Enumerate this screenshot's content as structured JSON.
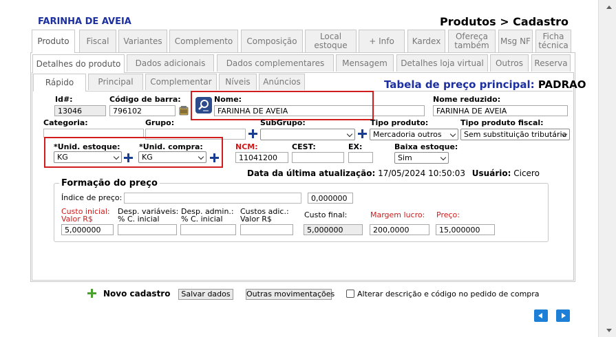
{
  "record_title": "FARINHA DE AVEIA",
  "page_heading": "Produtos > Cadastro",
  "tabs_l1": [
    "Produto",
    "Fiscal",
    "Variantes",
    "Complemento",
    "Composição",
    "Local estoque",
    "+ Info",
    "Kardex",
    "Ofereça também",
    "Msg NF",
    "Ficha técnica"
  ],
  "tabs_l2": [
    "Detalhes do produto",
    "Dados adicionais",
    "Dados complementares",
    "Mensagem",
    "Detalhes loja virtual",
    "Outros",
    "Reserva"
  ],
  "tabs_l3": [
    "Rápido",
    "Principal",
    "Complementar",
    "Níveis",
    "Anúncios"
  ],
  "price_table": {
    "label": "Tabela de preço principal:",
    "value": "PADRAO"
  },
  "form": {
    "id_label": "Id#:",
    "id_value": "13046",
    "barcode_label": "Código de barra:",
    "barcode_value": "796102",
    "name_label": "Nome:",
    "name_value": "FARINHA DE AVEIA",
    "short_name_label": "Nome reduzido:",
    "short_name_value": "FARINHA DE AVEIA",
    "category_label": "Categoria:",
    "group_label": "Grupo:",
    "subgroup_label": "SubGrupo:",
    "product_type_label": "Tipo produto:",
    "product_type_value": "Mercadoria outros",
    "fiscal_type_label": "Tipo produto fiscal:",
    "fiscal_type_value": "Sem substituição tributária",
    "stock_unit_label": "*Unid. estoque:",
    "stock_unit_value": "KG",
    "purchase_unit_label": "*Unid. compra:",
    "purchase_unit_value": "KG",
    "ncm_label": "NCM:",
    "ncm_value": "11041200",
    "cest_label": "CEST:",
    "ex_label": "EX:",
    "low_stock_label": "Baixa estoque:",
    "low_stock_value": "Sim",
    "last_update_label": "Data da última atualização:",
    "last_update_value": "17/05/2024 10:50:03",
    "user_label": "Usuário:",
    "user_value": "Cicero"
  },
  "pricing": {
    "legend": "Formação do preço",
    "index_label": "Índice de preço:",
    "index_value": "0,000000",
    "cost_label_1": "Custo inicial:",
    "cost_label_2": "Valor R$",
    "cost_value": "5,000000",
    "var_label_1": "Desp. variáveis:",
    "var_label_2": "% C. inicial",
    "adm_label_1": "Desp. admin.:",
    "adm_label_2": "% C. inicial",
    "add_label_1": "Custos adic.:",
    "add_label_2": "Valor R$",
    "final_label": "Custo final:",
    "final_value": "5,000000",
    "margin_label": "Margem lucro:",
    "margin_value": "200,0000",
    "price_label": "Preço:",
    "price_value": "15,000000"
  },
  "actions": {
    "new": "Novo cadastro",
    "save": "Salvar dados",
    "other": "Outras movimentações",
    "alter_checkbox": "Alterar descrição e código no pedido de compra"
  },
  "colors": {
    "title_blue": "#1c2fa0",
    "required_red": "#d21818",
    "highlight_red": "#d01c1c",
    "plus_blue": "#1a3d94",
    "nav_blue": "#1e7fd6"
  }
}
